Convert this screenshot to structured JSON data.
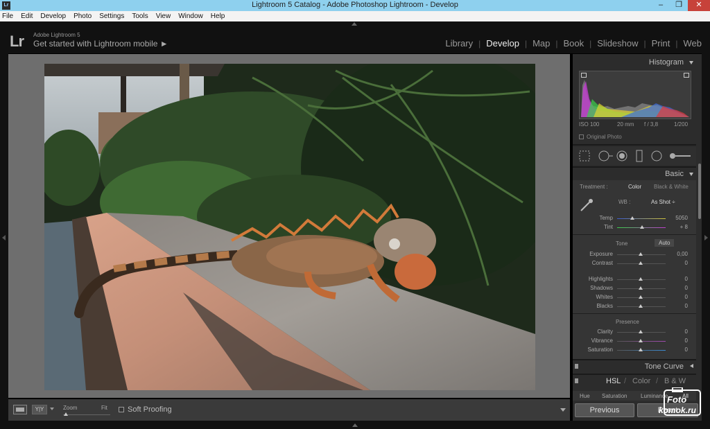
{
  "window": {
    "title": "Lightroom 5 Catalog - Adobe Photoshop Lightroom - Develop",
    "app_icon_text": "Lr",
    "controls": [
      "minimize-icon",
      "restore-icon",
      "close-icon"
    ]
  },
  "menu": [
    "File",
    "Edit",
    "Develop",
    "Photo",
    "Settings",
    "Tools",
    "View",
    "Window",
    "Help"
  ],
  "identity": {
    "logo": "Lr",
    "product": "Adobe Lightroom 5",
    "cta": "Get started with Lightroom mobile ►"
  },
  "modules": [
    {
      "label": "Library",
      "active": false
    },
    {
      "label": "Develop",
      "active": true
    },
    {
      "label": "Map",
      "active": false
    },
    {
      "label": "Book",
      "active": false
    },
    {
      "label": "Slideshow",
      "active": false
    },
    {
      "label": "Print",
      "active": false
    },
    {
      "label": "Web",
      "active": false
    }
  ],
  "toolbar": {
    "view_mode_2": "Y|Y",
    "zoom_label": "Zoom",
    "zoom_fit": "Fit",
    "soft_proofing": "Soft Proofing"
  },
  "histogram": {
    "title": "Histogram",
    "iso": "ISO 100",
    "focal": "20 mm",
    "aperture": "f / 3,8",
    "shutter": "1/200",
    "original_photo": "Original Photo"
  },
  "basic": {
    "title": "Basic",
    "treatment_label": "Treatment :",
    "treatment_color": "Color",
    "treatment_bw": "Black & White",
    "wb_label": "WB :",
    "wb_value": "As Shot ÷",
    "temp_label": "Temp",
    "temp_value": "5050",
    "tint_label": "Tint",
    "tint_value": "+ 8",
    "tone_label": "Tone",
    "auto_label": "Auto",
    "sliders": [
      {
        "label": "Exposure",
        "value": "0,00"
      },
      {
        "label": "Contrast",
        "value": "0"
      },
      {
        "label": "Highlights",
        "value": "0"
      },
      {
        "label": "Shadows",
        "value": "0"
      },
      {
        "label": "Whites",
        "value": "0"
      },
      {
        "label": "Blacks",
        "value": "0"
      }
    ],
    "presence_label": "Presence",
    "presence_sliders": [
      {
        "label": "Clarity",
        "value": "0"
      },
      {
        "label": "Vibrance",
        "value": "0"
      },
      {
        "label": "Saturation",
        "value": "0"
      }
    ]
  },
  "tone_curve": {
    "title": "Tone Curve"
  },
  "hsl": {
    "tabs": [
      "HSL",
      "/",
      "Color",
      "/",
      "B & W"
    ],
    "sub_tabs": [
      "Hue",
      "Saturation",
      "Luminance",
      "All"
    ]
  },
  "buttons": {
    "previous": "Previous",
    "reset": "Reset"
  },
  "watermark": {
    "line1": "Foto",
    "line2": "komok.ru"
  },
  "colors": {
    "titlebar": "#8ed0ee",
    "close_button": "#c7423a",
    "panel_bg": "#2c2c2c",
    "canvas_bg": "#6e6e6e"
  }
}
